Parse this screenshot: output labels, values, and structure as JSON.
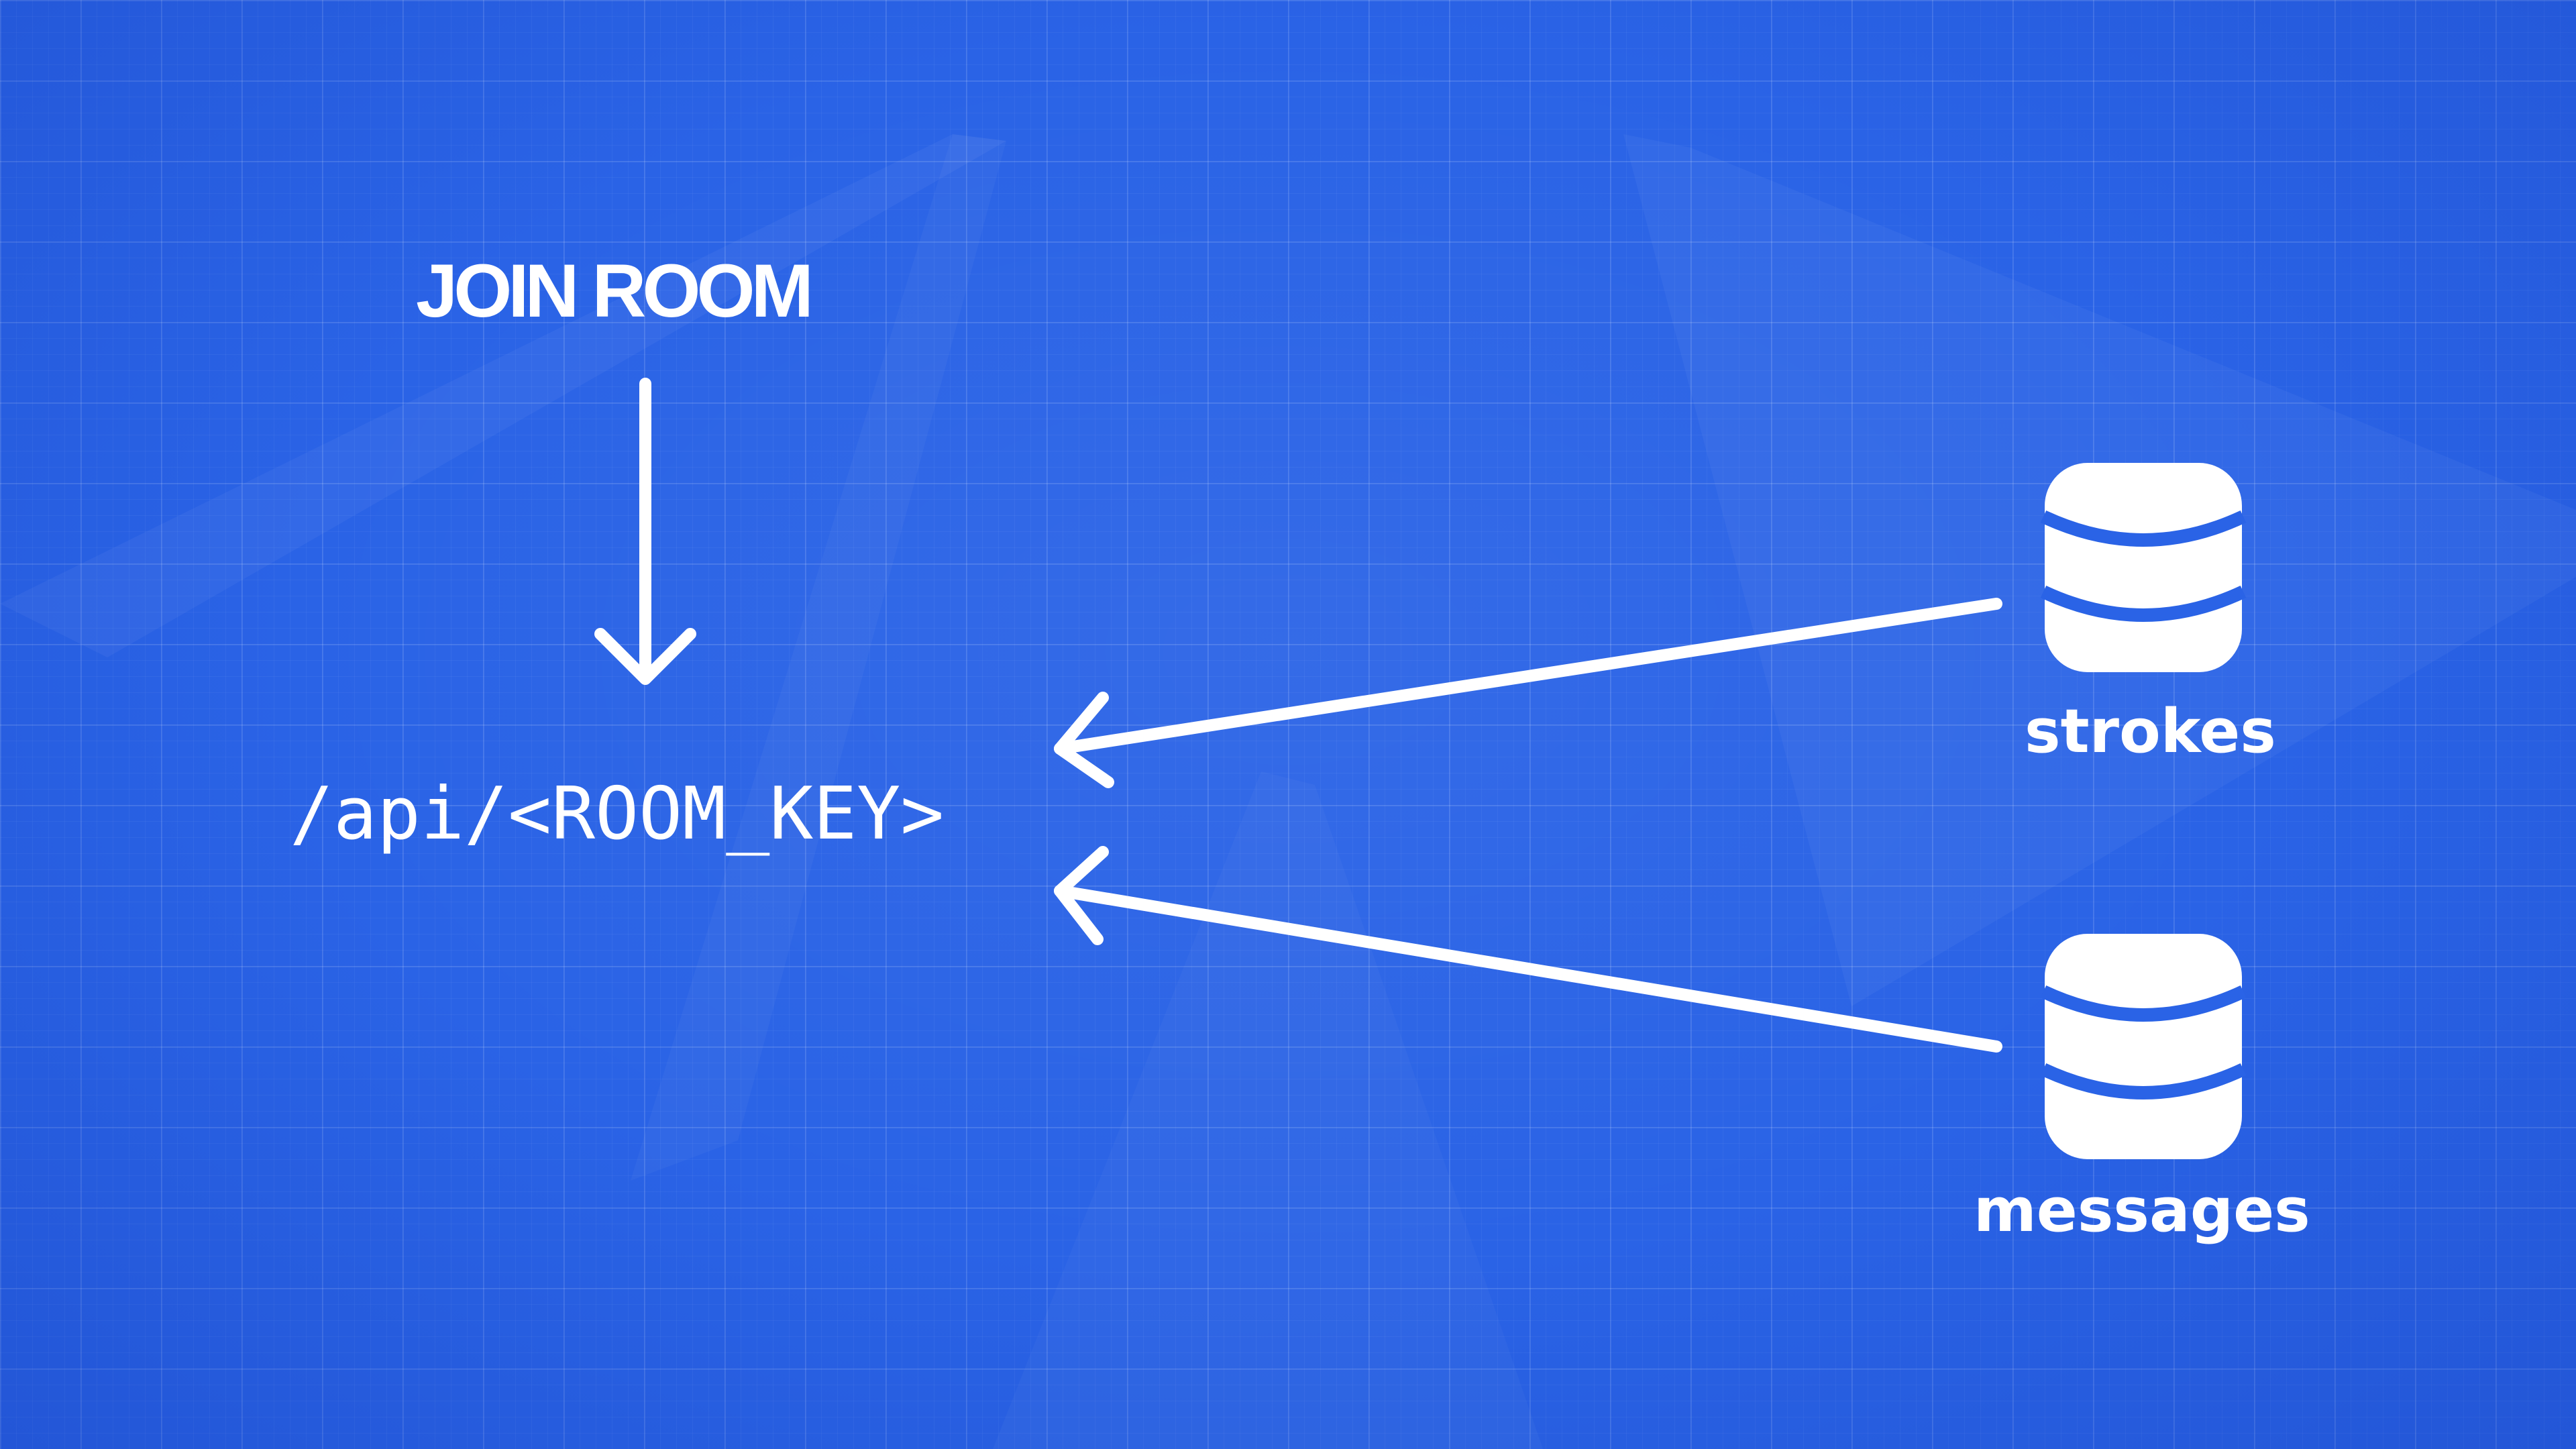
{
  "diagram": {
    "join_label": "JOIN ROOM",
    "api_label": "/api/<ROOM_KEY>",
    "databases": [
      {
        "label": "strokes",
        "icon": "database-icon"
      },
      {
        "label": "messages",
        "icon": "database-icon"
      }
    ]
  },
  "colors": {
    "background": "#2a63e6",
    "foreground": "#ffffff"
  }
}
